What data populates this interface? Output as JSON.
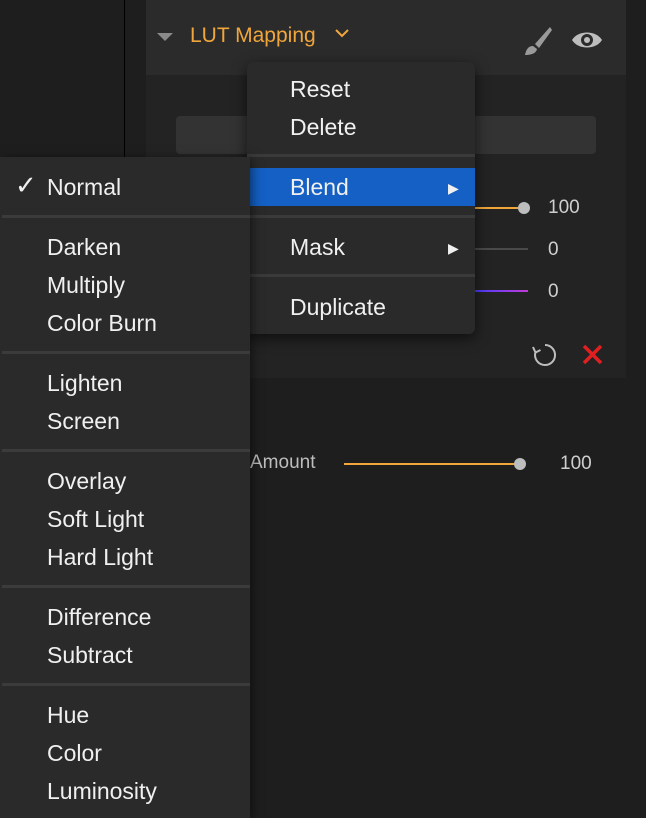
{
  "panel": {
    "title": "LUT Mapping",
    "sliders": [
      {
        "value": "100"
      },
      {
        "value": "0"
      },
      {
        "value": "0"
      }
    ],
    "amount": {
      "label": "Amount",
      "value": "100"
    }
  },
  "menu": {
    "items": [
      "Reset",
      "Delete",
      "Blend",
      "Mask",
      "Duplicate"
    ]
  },
  "blend_menu": {
    "selected": "Normal",
    "items": [
      "Normal",
      "Darken",
      "Multiply",
      "Color Burn",
      "Lighten",
      "Screen",
      "Overlay",
      "Soft Light",
      "Hard Light",
      "Difference",
      "Subtract",
      "Hue",
      "Color",
      "Luminosity"
    ]
  },
  "colors": {
    "accent": "#f0a63a",
    "highlight": "#1460c4",
    "close": "#e02020"
  }
}
